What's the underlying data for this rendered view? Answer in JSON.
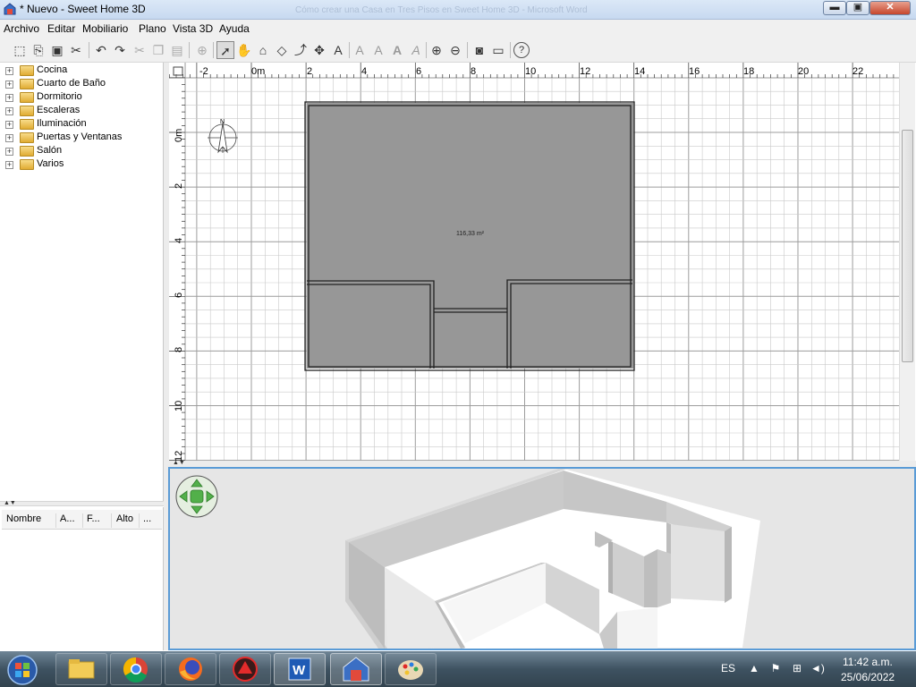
{
  "window": {
    "title": "* Nuevo - Sweet Home 3D",
    "background_title": "Cómo crear una Casa en Tres Pisos en Sweet Home 3D    -    Microsoft Word",
    "minimize": "▬",
    "maximize": "▣",
    "close": "✕"
  },
  "menu": {
    "items": [
      "Archivo",
      "Editar",
      "Mobiliario",
      "Plano",
      "Vista 3D",
      "Ayuda"
    ]
  },
  "toolbar": {
    "icons": [
      "new-home-icon",
      "open-icon",
      "save-icon",
      "cut-tool-icon",
      "undo-icon",
      "redo-icon",
      "cut-icon",
      "copy-icon",
      "paste-icon",
      "add-furniture-icon",
      "select-mode-icon",
      "pan-mode-icon",
      "create-walls-icon",
      "create-rooms-icon",
      "create-polylines-icon",
      "create-dimensions-icon",
      "add-text-icon",
      "increase-text-icon",
      "decrease-text-icon",
      "bold-text-icon",
      "italic-text-icon",
      "zoom-in-icon",
      "zoom-out-icon",
      "create-photo-icon",
      "create-video-icon",
      "help-icon"
    ]
  },
  "catalog": {
    "categories": [
      "Cocina",
      "Cuarto de Baño",
      "Dormitorio",
      "Escaleras",
      "Iluminación",
      "Puertas y Ventanas",
      "Salón",
      "Varios"
    ]
  },
  "furniture_table": {
    "columns": [
      "Nombre",
      "A...",
      "F...",
      "Alto",
      "..."
    ]
  },
  "plan": {
    "ruler_x": [
      "-2",
      "0m",
      "2",
      "4",
      "6",
      "8",
      "10",
      "12",
      "14",
      "16",
      "18",
      "20",
      "22"
    ],
    "ruler_y": [
      "0m",
      "2",
      "4",
      "6",
      "8",
      "10",
      "12"
    ],
    "room_area": "116,33 m²",
    "compass_label": "N",
    "colors": {
      "room": "#979797",
      "wall": "#2a2a2a",
      "grid": "#c9c9c9",
      "grid_major": "#9c9c9c"
    }
  },
  "taskbar": {
    "language": "ES",
    "time": "11:42 a.m.",
    "date": "25/06/2022",
    "apps": [
      "file-explorer-icon",
      "chrome-icon",
      "firefox-icon",
      "app-red-icon",
      "word-icon",
      "sweet-home-3d-icon",
      "paint-icon"
    ]
  }
}
